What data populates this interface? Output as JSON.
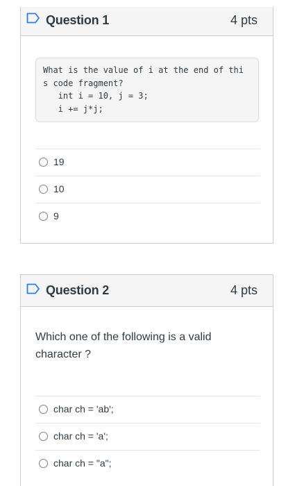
{
  "questions": [
    {
      "title": "Question 1",
      "points": "4 pts",
      "code": "What is the value of i at the end of thi\ns code fragment?\n   int i = 10, j = 3;\n   i += j*j;",
      "answers": [
        {
          "label": "19"
        },
        {
          "label": "10"
        },
        {
          "label": "9"
        }
      ]
    },
    {
      "title": "Question 2",
      "points": "4 pts",
      "text": "Which one of the following is a valid character ?",
      "answers": [
        {
          "label": "char ch = 'ab';"
        },
        {
          "label": "char ch = 'a';"
        },
        {
          "label": "char ch = \"a\";"
        }
      ]
    }
  ],
  "icons": {
    "flag": "flag-icon",
    "radio": "radio-button"
  },
  "colors": {
    "flag_outline": "#2d7be5",
    "text": "#2d3b45",
    "border": "#c7cdd1",
    "header_bg": "#f5f5f5"
  }
}
